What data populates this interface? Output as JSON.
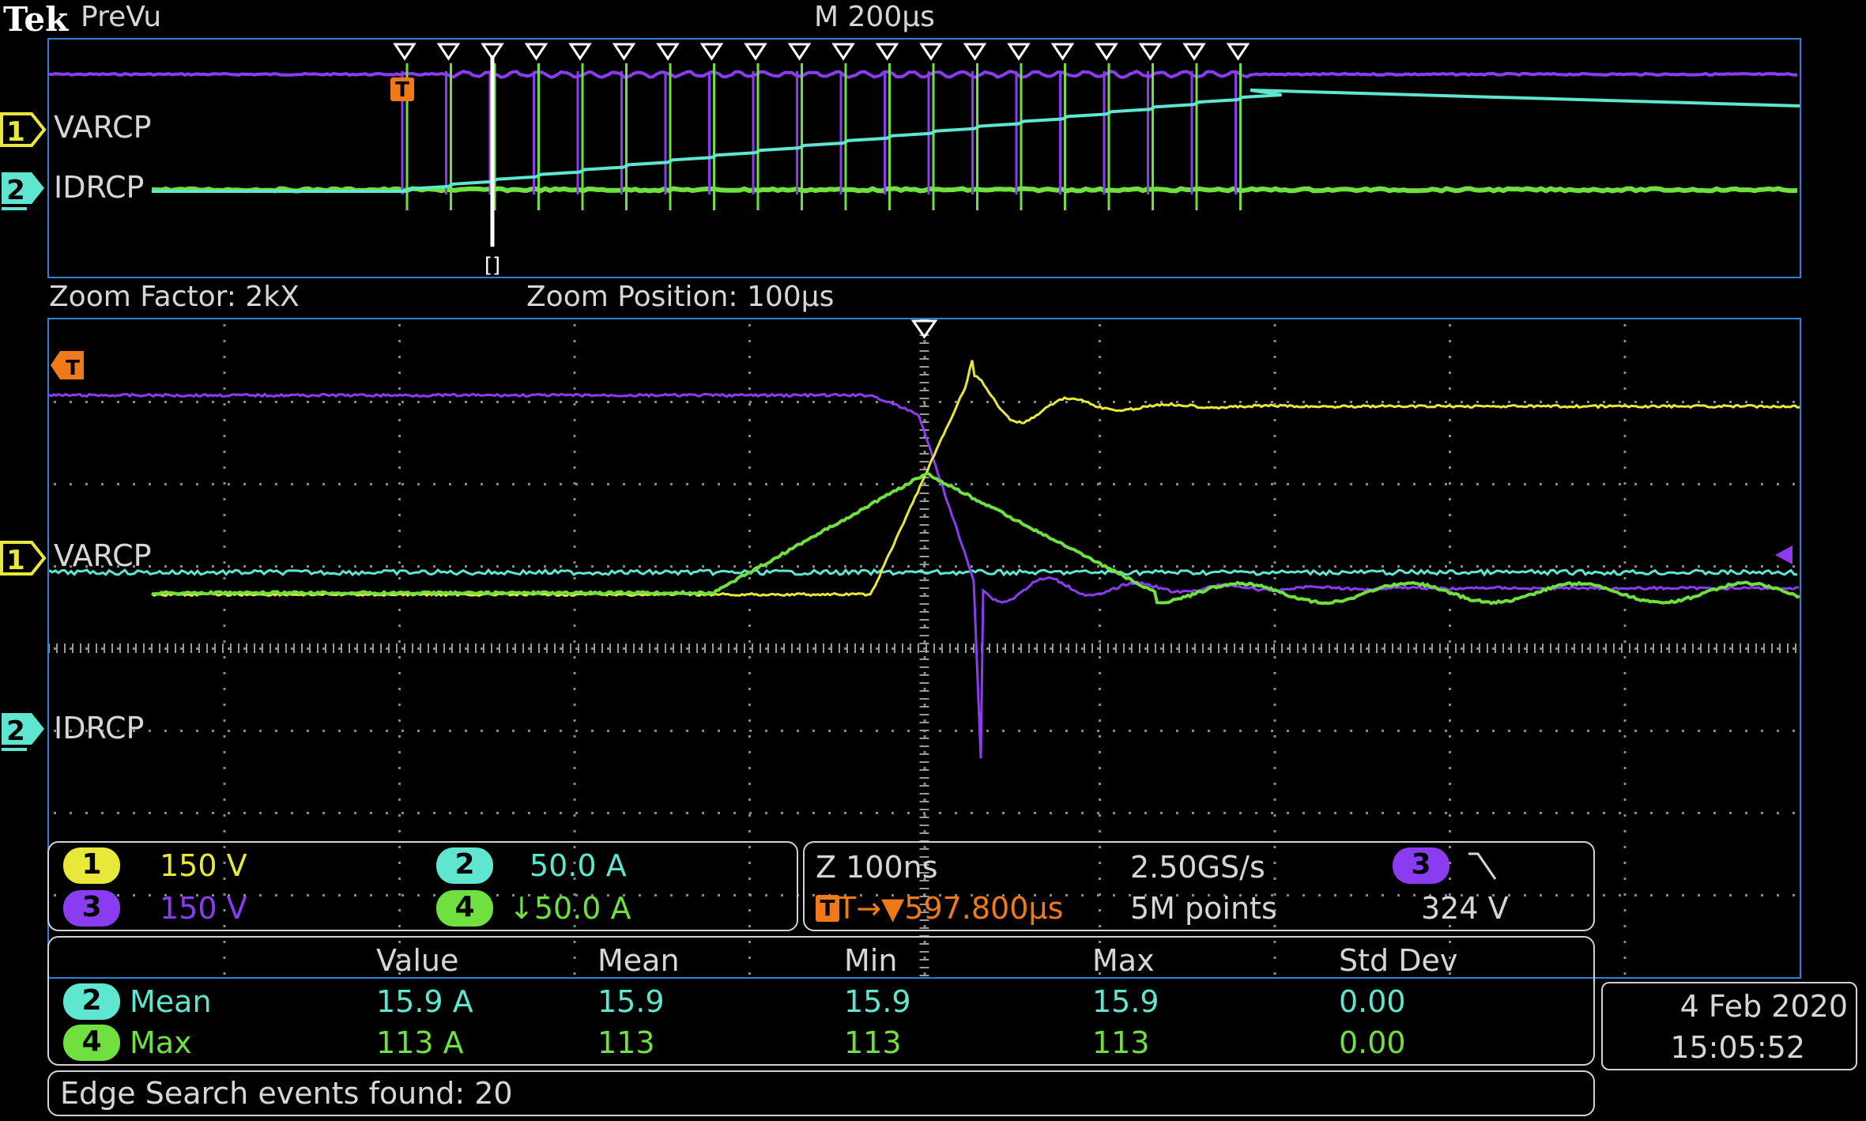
{
  "header": {
    "brand": "Tek",
    "mode": "PreVu",
    "timebase": "M 200µs"
  },
  "overview": {
    "ch1_label": "VARCP",
    "ch2_label": "IDRCP",
    "ch1_marker": "1",
    "ch2_marker": "2",
    "trigger_marker": "T",
    "zoom_box_marker": "[]",
    "search_event_count": 20
  },
  "zoom_info": {
    "factor": "Zoom Factor: 2kX",
    "position": "Zoom Position: 100µs"
  },
  "zoom_view": {
    "ch1_label": "VARCP",
    "ch2_label": "IDRCP",
    "ch1_marker": "1",
    "ch2_marker": "2",
    "trigger_marker": "T"
  },
  "channels": {
    "ch1": {
      "num": "1",
      "scale": "150 V",
      "color": "#e8e83a"
    },
    "ch2": {
      "num": "2",
      "scale": "50.0 A",
      "color": "#5fe6d0"
    },
    "ch3": {
      "num": "3",
      "scale": "150 V",
      "color": "#8c3cf0"
    },
    "ch4": {
      "num": "4",
      "scale": "↓50.0 A",
      "color": "#6fe040"
    }
  },
  "acquisition": {
    "zoom_time": "Z 100ns",
    "sample_rate": "2.50GS/s",
    "trigger_source": "3",
    "trigger_slope_icon": "falling-edge-icon",
    "trigger_position": "T→▼597.800µs",
    "record_length": "5M points",
    "trigger_level": "324 V"
  },
  "measurements": {
    "headers": [
      "Value",
      "Mean",
      "Min",
      "Max",
      "Std Dev"
    ],
    "rows": [
      {
        "channel": "2",
        "name": "Mean",
        "value": "15.9 A",
        "mean": "15.9",
        "min": "15.9",
        "max": "15.9",
        "std": "0.00",
        "color": "#5fe6d0"
      },
      {
        "channel": "4",
        "name": "Max",
        "value": "113 A",
        "mean": "113",
        "min": "113",
        "max": "113",
        "std": "0.00",
        "color": "#6fe040"
      }
    ]
  },
  "datetime": {
    "date": "4 Feb  2020",
    "time": "15:05:52"
  },
  "status": {
    "search_message": "Edge Search events found: 20"
  },
  "colors": {
    "orange": "#f07a1a",
    "frame": "#2f7fd6"
  }
}
